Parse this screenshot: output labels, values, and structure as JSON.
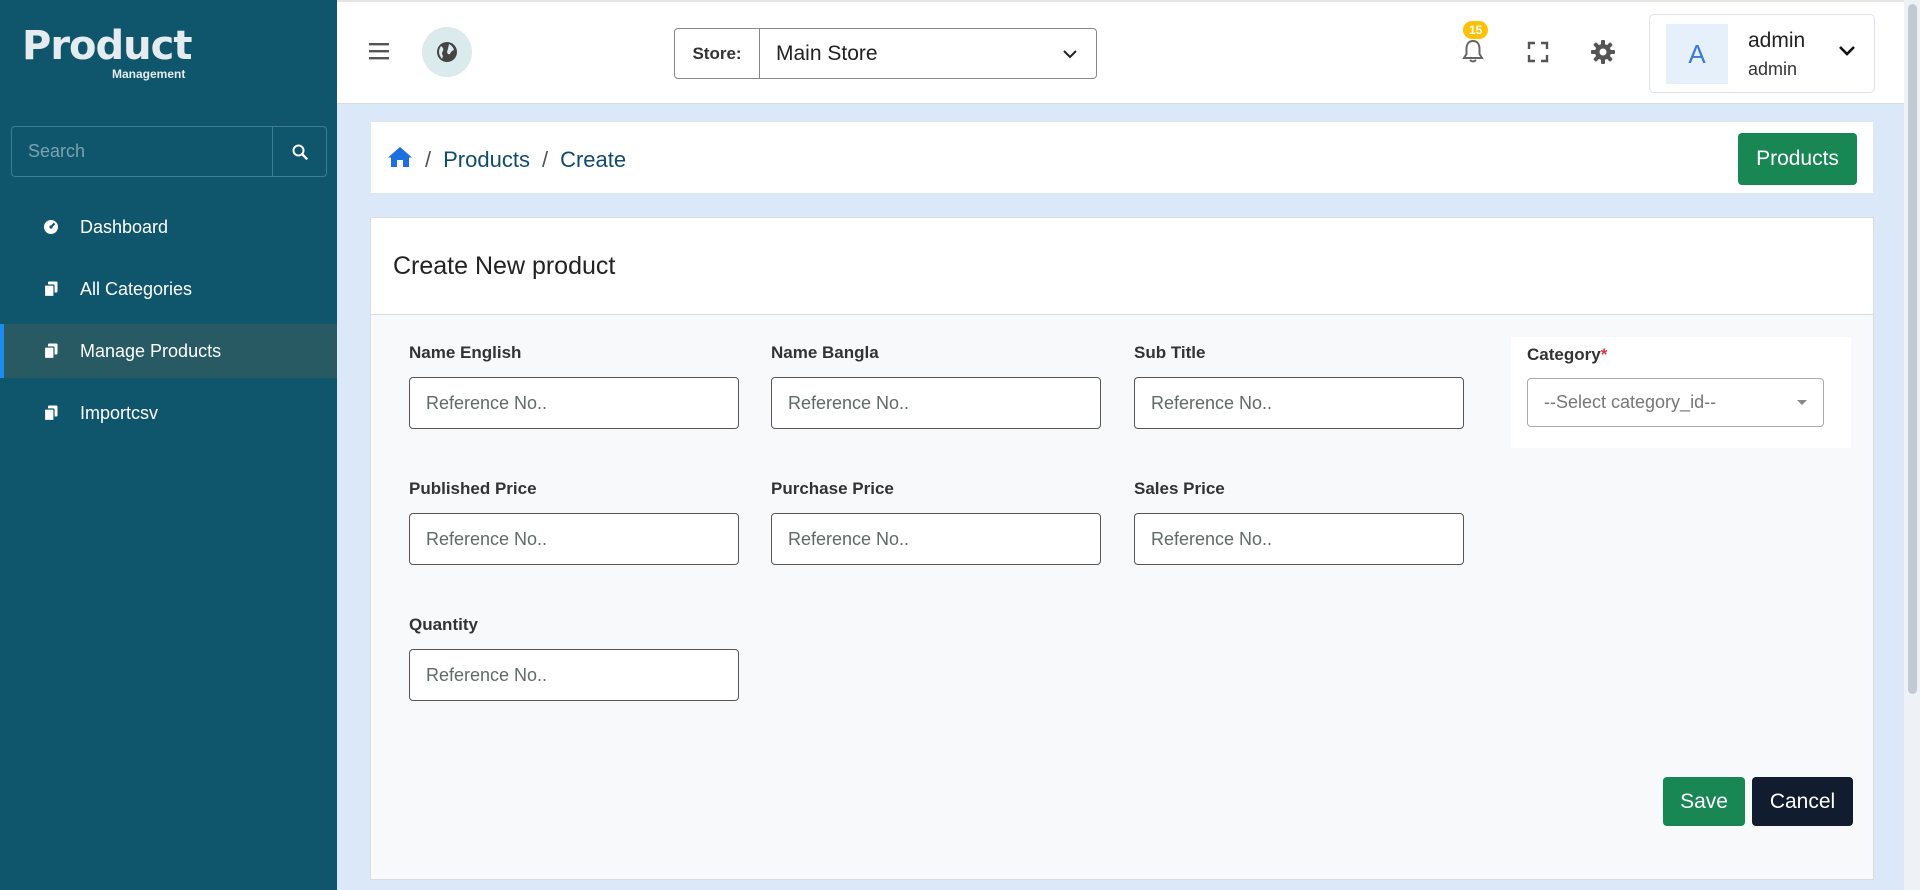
{
  "sidebar": {
    "logo_main": "Product",
    "logo_sub": "Management",
    "search_placeholder": "Search",
    "items": [
      {
        "label": "Dashboard",
        "icon": "dashboard-icon"
      },
      {
        "label": "All Categories",
        "icon": "copy-icon"
      },
      {
        "label": "Manage Products",
        "icon": "copy-icon",
        "active": true
      },
      {
        "label": "Importcsv",
        "icon": "copy-icon"
      }
    ]
  },
  "header": {
    "store_label": "Store:",
    "store_value": "Main Store",
    "notification_count": "15",
    "user": {
      "avatar_letter": "A",
      "name": "admin",
      "role": "admin"
    }
  },
  "breadcrumb": {
    "items": [
      "Products",
      "Create"
    ],
    "separator": "/",
    "products_button": "Products"
  },
  "form": {
    "title": "Create New product",
    "placeholder": "Reference No..",
    "fields": {
      "name_english": "Name English",
      "name_bangla": "Name Bangla",
      "sub_title": "Sub Title",
      "published_price": "Published Price",
      "purchase_price": "Purchase Price",
      "sales_price": "Sales Price",
      "quantity": "Quantity"
    },
    "category": {
      "label": "Category",
      "required_mark": "*",
      "placeholder": "--Select category_id--"
    },
    "save_label": "Save",
    "cancel_label": "Cancel"
  },
  "colors": {
    "sidebar_bg": "#0f566d",
    "active_item_bg": "#275a63",
    "primary_green": "#198754",
    "dark_button": "#111c2e",
    "badge": "#ffc107",
    "page_bg": "#dbe8f8"
  }
}
